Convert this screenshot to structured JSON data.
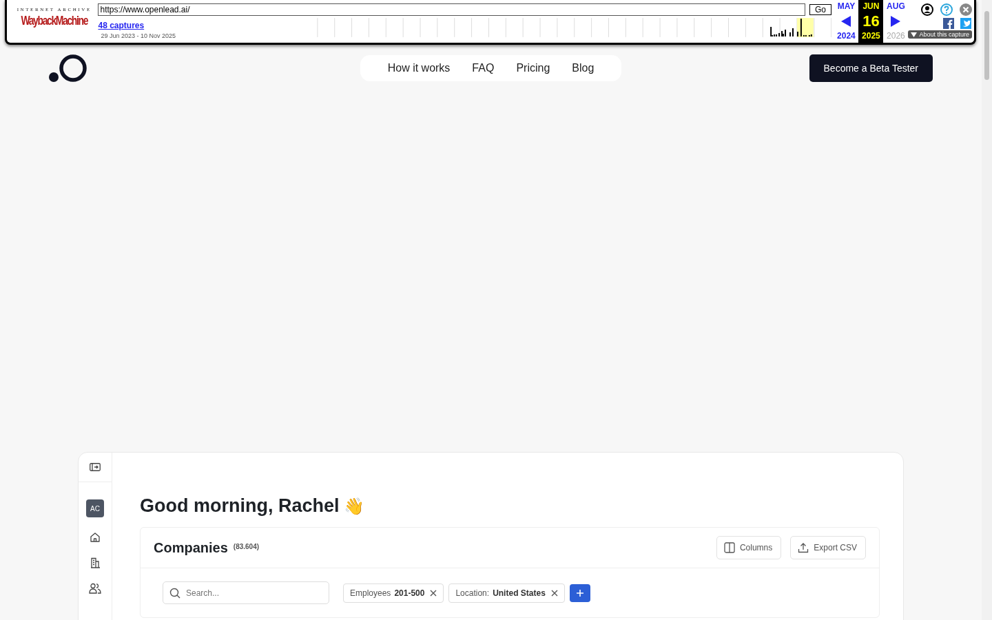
{
  "wayback": {
    "brand_top": "INTERNET ARCHIVE",
    "brand_name": "WaybackMachine",
    "url": "https://www.openlead.ai/",
    "go": "Go",
    "captures": "48 captures",
    "date_range": "29 Jun 2023 - 10 Nov 2025",
    "months": [
      {
        "label": "MAY",
        "selected": false
      },
      {
        "label": "JUN",
        "selected": true
      },
      {
        "label": "AUG",
        "selected": false
      }
    ],
    "day": "16",
    "years": [
      {
        "label": "2024",
        "selected": false,
        "disabled": false
      },
      {
        "label": "2025",
        "selected": true,
        "disabled": false
      },
      {
        "label": "2026",
        "selected": false,
        "disabled": true
      }
    ],
    "about": "About this capture"
  },
  "nav": {
    "links": [
      "How it works",
      "FAQ",
      "Pricing",
      "Blog"
    ],
    "cta": "Become a Beta Tester"
  },
  "app": {
    "avatar": "AC",
    "greeting": "Good morning, Rachel",
    "emoji": "👋",
    "panel": {
      "title": "Companies",
      "count": "(83.604)",
      "buttons": [
        {
          "kind": "columns",
          "label": "Columns"
        },
        {
          "kind": "export",
          "label": "Export CSV"
        }
      ],
      "search": {
        "placeholder": "Search..."
      },
      "filters": [
        {
          "name": "Employees",
          "value": "201-500"
        },
        {
          "name": "Location:",
          "value": "United States"
        }
      ]
    }
  }
}
